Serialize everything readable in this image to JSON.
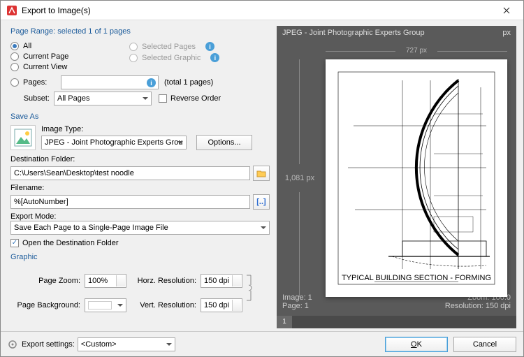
{
  "window": {
    "title": "Export to Image(s)"
  },
  "pageRange": {
    "heading": "Page Range: selected 1 of 1 pages",
    "all": "All",
    "currentPage": "Current Page",
    "currentView": "Current View",
    "pages": "Pages:",
    "selectedPages": "Selected Pages",
    "selectedGraphic": "Selected Graphic",
    "totalPages": "(total 1 pages)",
    "subsetLabel": "Subset:",
    "subsetValue": "All Pages",
    "reverseOrder": "Reverse Order",
    "pagesValue": ""
  },
  "saveAs": {
    "heading": "Save As",
    "imageTypeLabel": "Image Type:",
    "imageTypeValue": "JPEG - Joint Photographic Experts Group",
    "optionsBtn": "Options...",
    "destFolderLabel": "Destination Folder:",
    "destFolderValue": "C:\\Users\\Sean\\Desktop\\test noodle",
    "filenameLabel": "Filename:",
    "filenameValue": "%[AutoNumber]",
    "exportModeLabel": "Export Mode:",
    "exportModeValue": "Save Each Page to a Single-Page Image File",
    "openDestFolder": "Open the Destination Folder"
  },
  "graphic": {
    "heading": "Graphic",
    "pageZoomLabel": "Page Zoom:",
    "pageZoomValue": "100%",
    "pageBgLabel": "Page Background:",
    "pageBgValue": "",
    "horzResLabel": "Horz. Resolution:",
    "horzResValue": "150 dpi",
    "vertResLabel": "Vert. Resolution:",
    "vertResValue": "150 dpi"
  },
  "preview": {
    "formatLabel": "JPEG - Joint Photographic Experts Group",
    "pxUnit": "px",
    "widthLabel": "727 px",
    "heightLabel": "1,081 px",
    "imageLabel": "Image: 1",
    "pageLabel": "Page: 1",
    "zoomLabel": "Zoom: 100.0",
    "resLabel": "Resolution: 150 dpi",
    "tab1": "1",
    "drawingCaption": "TYPICAL BUILDING SECTION - FORMING"
  },
  "footer": {
    "exportSettingsLabel": "Export settings:",
    "exportSettingsValue": "<Custom>",
    "ok": "OK",
    "cancel": "Cancel"
  }
}
